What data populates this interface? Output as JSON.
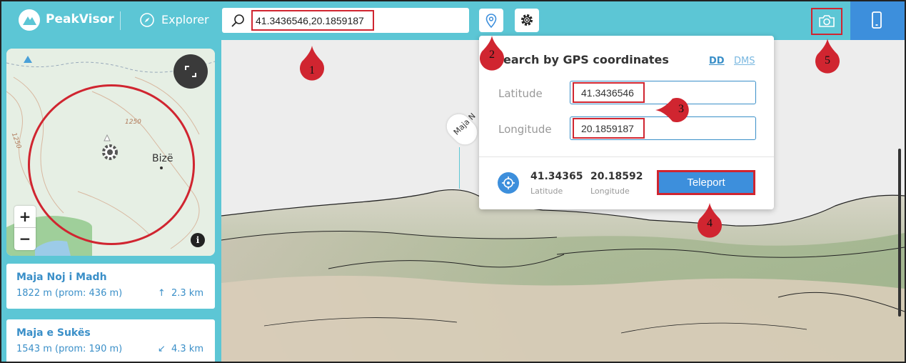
{
  "app": {
    "brand": "PeakVisor",
    "section": "Explorer"
  },
  "search": {
    "value": "41.3436546,20.1859187"
  },
  "minimap": {
    "town": "Bizë",
    "elevation_labels": [
      "1250",
      "1250"
    ],
    "zoom_in": "+",
    "zoom_out": "−",
    "info": "i"
  },
  "peaks": [
    {
      "name": "Maja Noj i Madh",
      "meta": "1822 m (prom: 436 m)",
      "distance": "2.3 km",
      "arrow": "↑"
    },
    {
      "name": "Maja e Sukës",
      "meta": "1543 m (prom: 190 m)",
      "distance": "4.3 km",
      "arrow": "↙"
    }
  ],
  "view3d": {
    "peak_tag": "Maja N"
  },
  "gps_popup": {
    "title": "Search by GPS coordinates",
    "title_visible": "earch by GPS coordinates",
    "mode_dd": "DD",
    "mode_dms": "DMS",
    "latitude_label": "Latitude",
    "longitude_label": "Longitude",
    "latitude_value": "41.3436546",
    "longitude_value": "20.1859187",
    "result_lat": "41.34365",
    "result_lon": "20.18592",
    "result_lat_label": "Latitude",
    "result_lon_label": "Longitude",
    "teleport_label": "Teleport"
  },
  "annotations": [
    "1",
    "2",
    "3",
    "4",
    "5"
  ],
  "colors": {
    "topbar": "#5cc6d5",
    "accent": "#3d8fdc",
    "annotation_red": "#d02530",
    "link": "#3a8fc8"
  }
}
